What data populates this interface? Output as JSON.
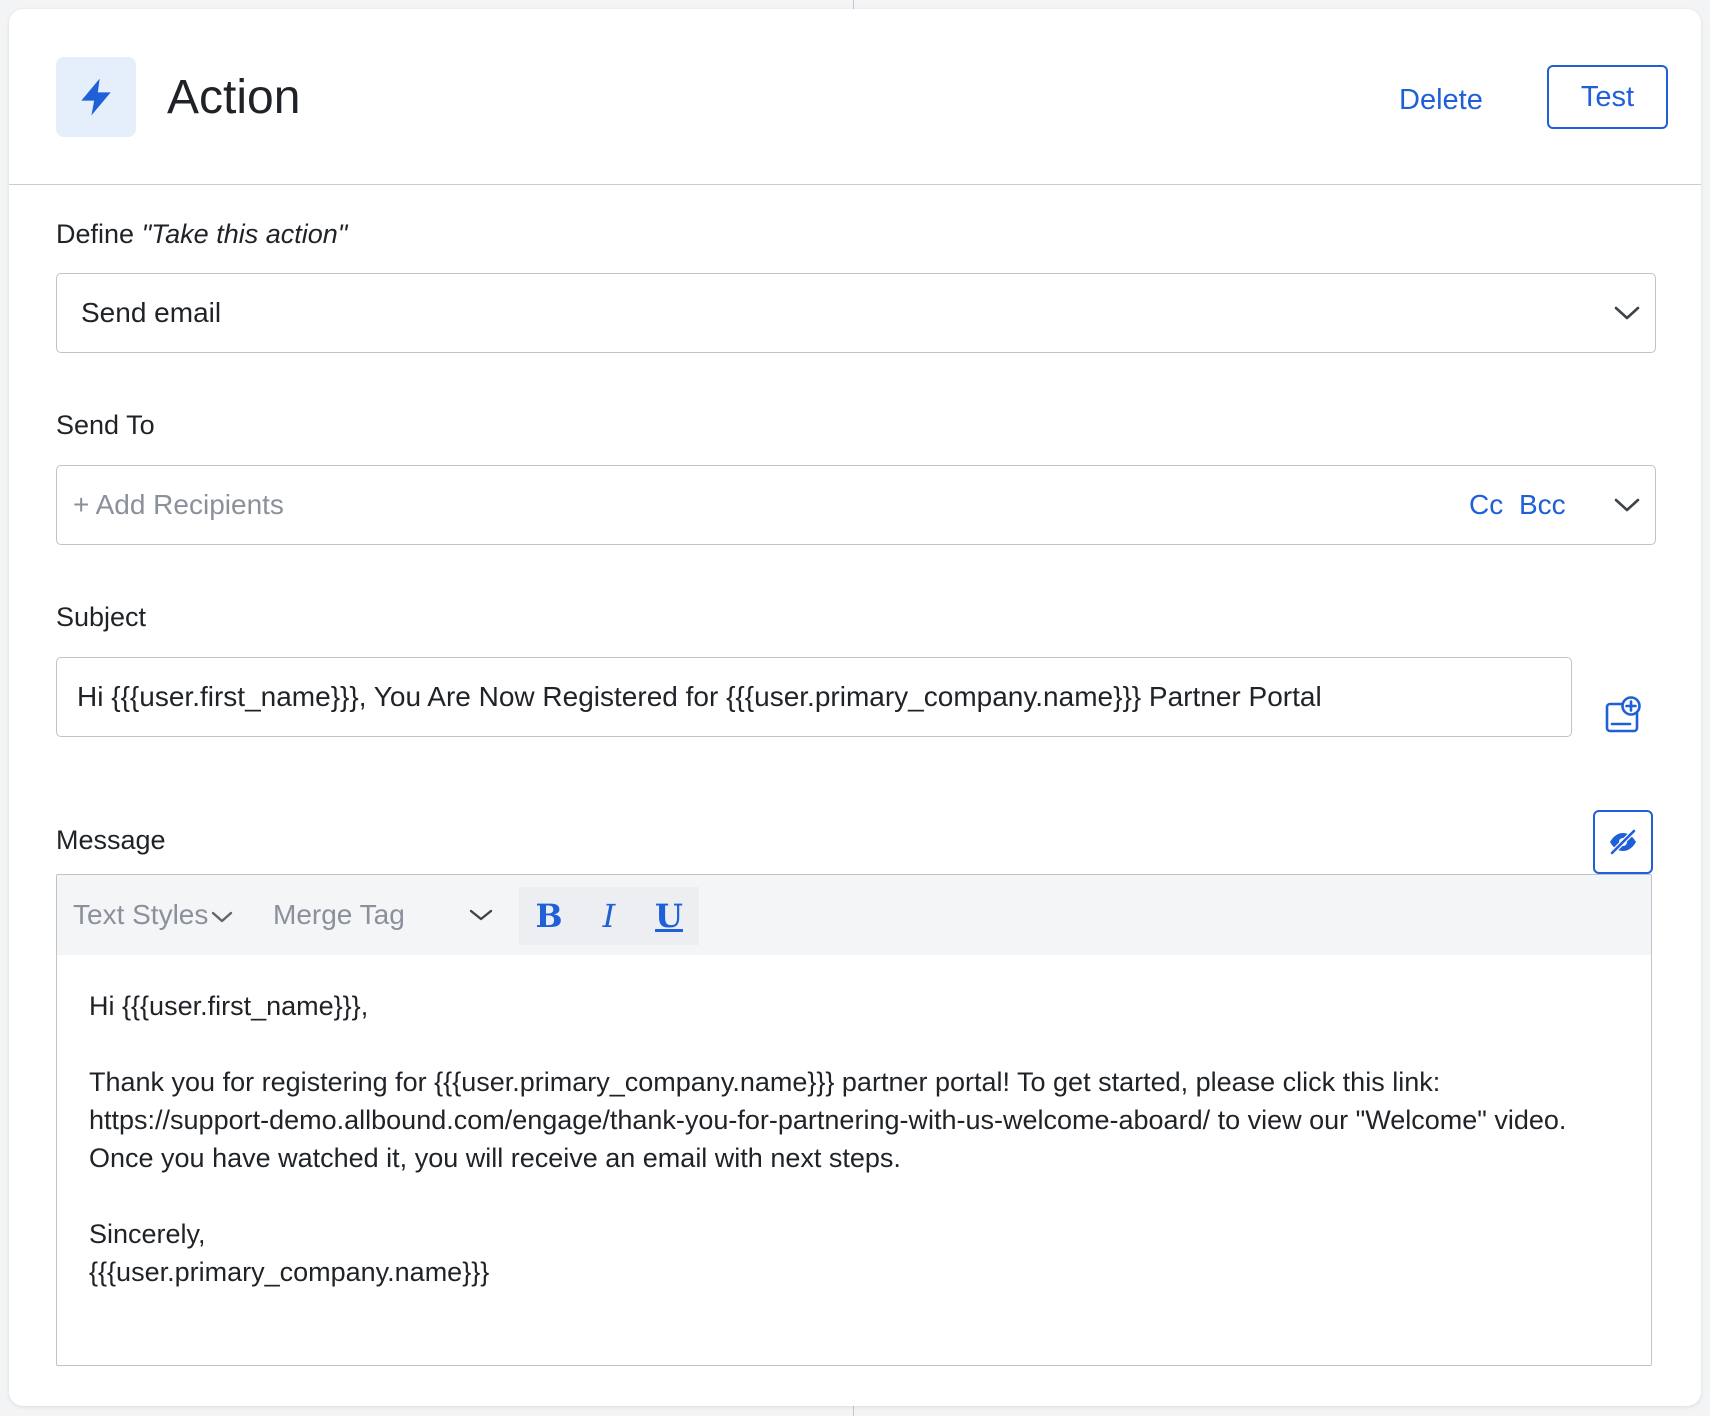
{
  "header": {
    "icon": "lightning-bolt-icon",
    "title": "Action",
    "delete_label": "Delete",
    "test_label": "Test"
  },
  "define": {
    "label_prefix": "Define ",
    "label_emphasis": "\"Take this action\"",
    "selected_value": "Send email"
  },
  "send_to": {
    "label": "Send To",
    "placeholder": "+ Add Recipients",
    "cc_label": "Cc",
    "bcc_label": "Bcc"
  },
  "subject": {
    "label": "Subject",
    "value": "Hi {{{user.first_name}}}, You Are Now Registered for {{{user.primary_company.name}}} Partner Portal",
    "side_icon": "add-merge-tag-icon"
  },
  "message": {
    "label": "Message",
    "toggle_icon": "eye-off-icon",
    "toolbar": {
      "text_styles": "Text Styles",
      "merge_tag": "Merge Tag",
      "bold": "B",
      "italic": "I",
      "underline": "U"
    },
    "body": {
      "greeting": "Hi {{{user.first_name}}},",
      "paragraph": "Thank you for registering for {{{user.primary_company.name}}} partner portal! To get started, please click this link: https://support-demo.allbound.com/engage/thank-you-for-partnering-with-us-welcome-aboard/ to view our \"Welcome\" video. Once you have watched it, you will receive an email with next steps.",
      "closing": "Sincerely,",
      "signature": "{{{user.primary_company.name}}}"
    }
  },
  "colors": {
    "accent": "#1f5fd8",
    "icon_bg": "#e5eefb",
    "text": "#1f2328",
    "placeholder": "#8a919b",
    "border": "#bfc3c9"
  }
}
